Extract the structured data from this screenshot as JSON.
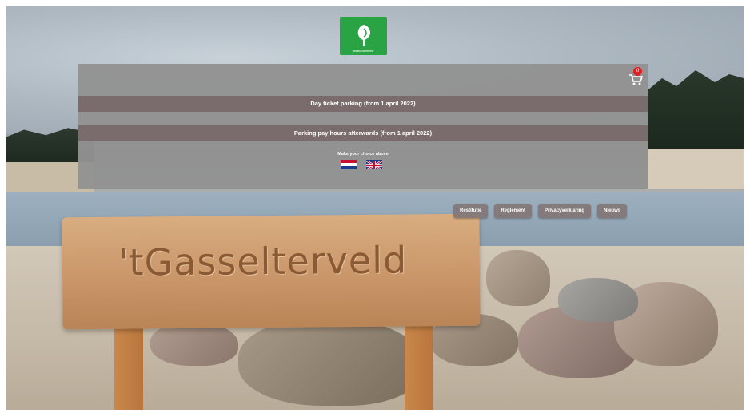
{
  "header": {
    "logo": {
      "text": "staatsbosbeheer",
      "icon": "tree-leaf-icon"
    }
  },
  "panel": {
    "cart": {
      "icon": "cart-icon",
      "count": "0"
    },
    "options": [
      {
        "label": "Day ticket parking (from 1 april 2022)"
      },
      {
        "label": "Parking pay hours afterwards (from 1 april 2022)"
      }
    ],
    "choice_text": "Make your choice above",
    "languages": [
      {
        "icon": "flag-nl-icon",
        "name": "Nederlands"
      },
      {
        "icon": "flag-uk-icon",
        "name": "English"
      }
    ]
  },
  "nav": {
    "items": [
      {
        "label": "Restitutie"
      },
      {
        "label": "Reglement"
      },
      {
        "label": "Privacyverklaring"
      },
      {
        "label": "Nieuws"
      }
    ]
  },
  "background": {
    "sign_text": "'tGasselterveld"
  },
  "colors": {
    "logo_green": "#2aa344",
    "panel_gray": "#929292",
    "bar_brown": "#7a6c6c",
    "badge_red": "#e02020"
  }
}
